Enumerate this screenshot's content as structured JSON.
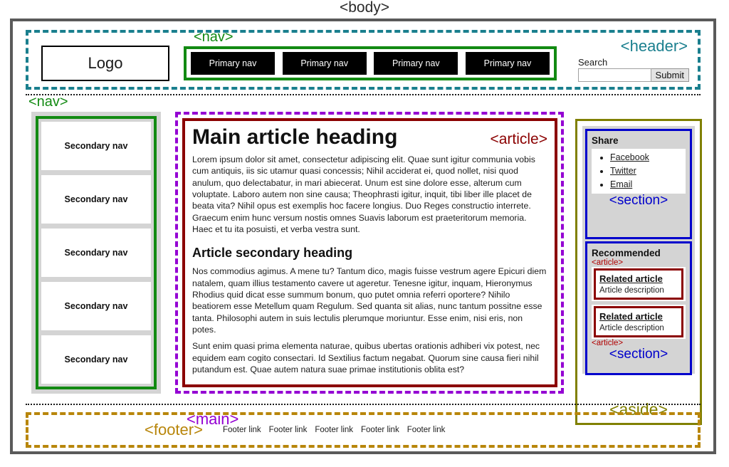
{
  "page": {
    "body_tag": "<body>"
  },
  "header": {
    "tag": "<header>",
    "logo": "Logo",
    "search": {
      "label": "Search",
      "value": "",
      "placeholder": "",
      "submit_label": "Submit"
    }
  },
  "primary_nav": {
    "tag": "<nav>",
    "items": [
      {
        "label": "Primary nav"
      },
      {
        "label": "Primary nav"
      },
      {
        "label": "Primary nav"
      },
      {
        "label": "Primary nav"
      }
    ]
  },
  "secondary_nav": {
    "tag": "<nav>",
    "items": [
      {
        "label": "Secondary nav"
      },
      {
        "label": "Secondary nav"
      },
      {
        "label": "Secondary nav"
      },
      {
        "label": "Secondary nav"
      },
      {
        "label": "Secondary nav"
      }
    ]
  },
  "main": {
    "tag": "<main>",
    "article": {
      "tag": "<article>",
      "heading": "Main article heading",
      "paragraph_1": "Lorem ipsum dolor sit amet, consectetur adipiscing elit. Quae sunt igitur communia vobis cum antiquis, iis sic utamur quasi concessis; Nihil acciderat ei, quod nollet, nisi quod anulum, quo delectabatur, in mari abiecerat. Unum est sine dolore esse, alterum cum voluptate. Laboro autem non sine causa; Theophrasti igitur, inquit, tibi liber ille placet de beata vita? Nihil opus est exemplis hoc facere longius. Duo Reges constructio interrete. Graecum enim hunc versum nostis omnes Suavis laborum est praeteritorum memoria. Haec et tu ita posuisti, et verba vestra sunt.",
      "secondary_heading": "Article secondary heading",
      "paragraph_2": "Nos commodius agimus. A mene tu? Tantum dico, magis fuisse vestrum agere Epicuri diem natalem, quam illius testamento cavere ut ageretur. Tenesne igitur, inquam, Hieronymus Rhodius quid dicat esse summum bonum, quo putet omnia referri oportere? Nihilo beatiorem esse Metellum quam Regulum. Sed quanta sit alias, nunc tantum possitne esse tanta. Philosophi autem in suis lectulis plerumque moriuntur. Esse enim, nisi eris, non potes.",
      "paragraph_3": "Sunt enim quasi prima elementa naturae, quibus ubertas orationis adhiberi vix potest, nec equidem eam cogito consectari. Id Sextilius factum negabat. Quorum sine causa fieri nihil putandum est. Quae autem natura suae primae institutionis oblita est?"
    }
  },
  "aside": {
    "tag": "<aside>",
    "share_section": {
      "tag": "<section>",
      "heading": "Share",
      "links": [
        {
          "label": "Facebook"
        },
        {
          "label": "Twitter"
        },
        {
          "label": "Email"
        }
      ]
    },
    "recommended_section": {
      "tag": "<section>",
      "heading": "Recommended",
      "article_tag_top": "<article>",
      "article_tag_bottom": "<article>",
      "items": [
        {
          "title": "Related article",
          "description": "Article description"
        },
        {
          "title": "Related article",
          "description": "Article description"
        }
      ]
    }
  },
  "footer": {
    "tag": "<footer>",
    "links": [
      {
        "label": "Footer link"
      },
      {
        "label": "Footer link"
      },
      {
        "label": "Footer link"
      },
      {
        "label": "Footer link"
      },
      {
        "label": "Footer link"
      }
    ]
  },
  "colors": {
    "body_border": "#5a5a5a",
    "header": "#1a7f8e",
    "nav": "#128a12",
    "main": "#9400D3",
    "article": "#8B0000",
    "section": "#0000CC",
    "aside": "#808000",
    "footer": "#B8860B"
  }
}
